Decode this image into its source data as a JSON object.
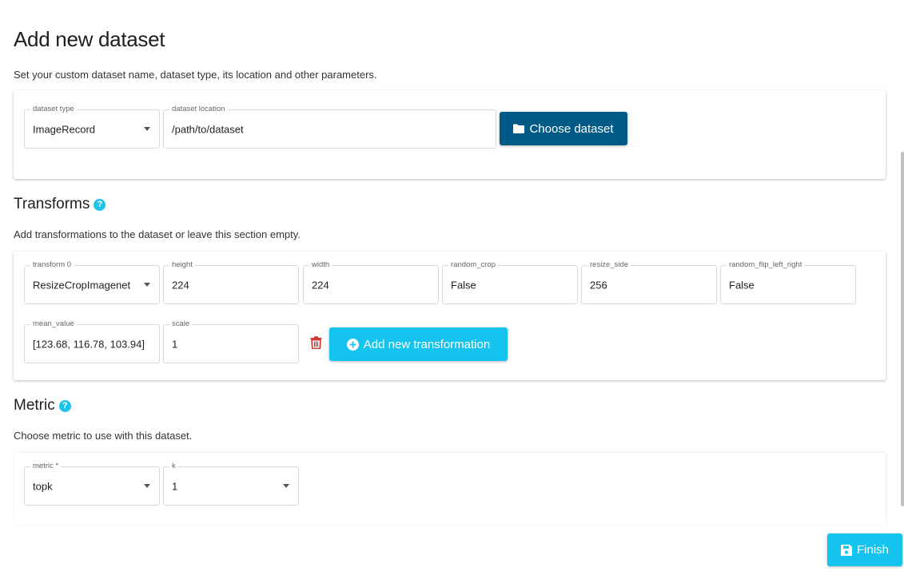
{
  "page": {
    "title": "Add new dataset",
    "description": "Set your custom dataset name, dataset type, its location and other parameters."
  },
  "dataset": {
    "type_label": "dataset type",
    "type_value": "ImageRecord",
    "location_label": "dataset location",
    "location_value": "/path/to/dataset",
    "choose_button": "Choose dataset"
  },
  "transforms": {
    "title": "Transforms",
    "help": "?",
    "description": "Add transformations to the dataset or leave this section empty.",
    "fields": {
      "transform": {
        "label": "transform 0",
        "value": "ResizeCropImagenet"
      },
      "height": {
        "label": "height",
        "value": "224"
      },
      "width": {
        "label": "width",
        "value": "224"
      },
      "random_crop": {
        "label": "random_crop",
        "value": "False"
      },
      "resize_side": {
        "label": "resize_side",
        "value": "256"
      },
      "random_flip": {
        "label": "random_flip_left_right",
        "value": "False"
      },
      "mean_value": {
        "label": "mean_value",
        "value": "[123.68, 116.78, 103.94]"
      },
      "scale": {
        "label": "scale",
        "value": "1"
      }
    },
    "add_button": "Add new transformation"
  },
  "metric": {
    "title": "Metric",
    "help": "?",
    "description": "Choose metric to use with this dataset.",
    "metric_label": "metric *",
    "metric_value": "topk",
    "k_label": "k",
    "k_value": "1"
  },
  "finish_button": "Finish",
  "colors": {
    "primary_dark": "#005a86",
    "accent_cyan": "#14c4ef",
    "help_icon": "#1ec3ea",
    "delete_icon": "#d32f2f"
  }
}
